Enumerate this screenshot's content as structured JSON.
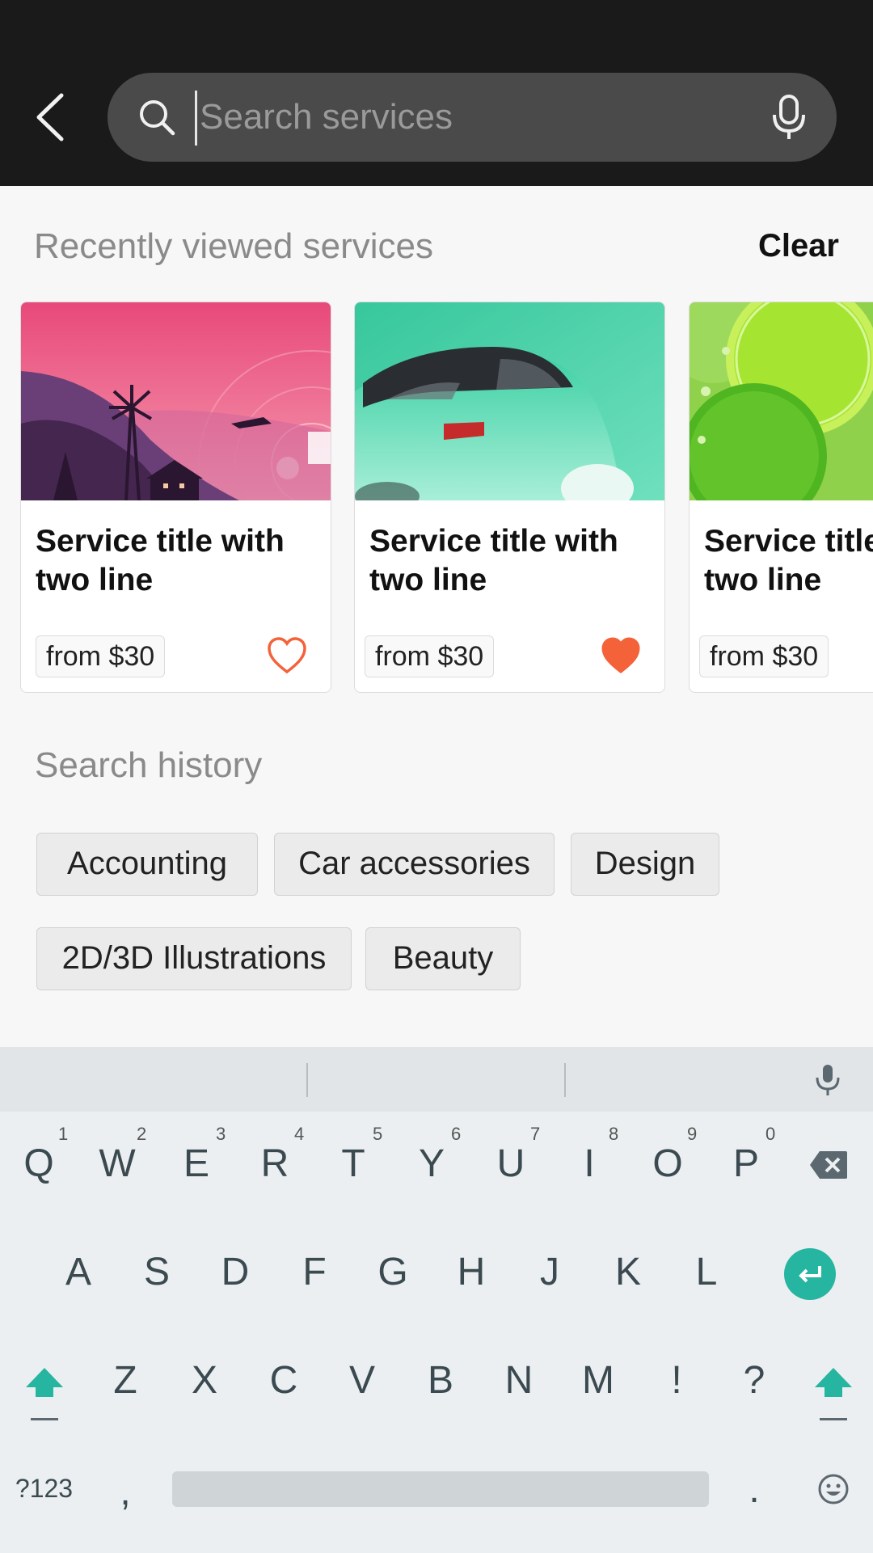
{
  "search": {
    "placeholder": "Search services",
    "value": ""
  },
  "recently_viewed": {
    "title": "Recently viewed services",
    "clear_label": "Clear",
    "cards": [
      {
        "title": "Service title with two line",
        "price": "from $30",
        "favorited": false,
        "image": "pink-landscape-windmill"
      },
      {
        "title": "Service title with two line",
        "price": "from $30",
        "favorited": true,
        "image": "green-car"
      },
      {
        "title": "Service title with two line",
        "price": "from $30",
        "favorited": false,
        "image": "lime-slices"
      }
    ]
  },
  "search_history": {
    "title": "Search history",
    "items": [
      "Accounting",
      "Car accessories",
      "Design",
      "2D/3D Illustrations",
      "Beauty"
    ]
  },
  "keyboard": {
    "row1": [
      "Q",
      "W",
      "E",
      "R",
      "T",
      "Y",
      "U",
      "I",
      "O",
      "P"
    ],
    "row1_nums": [
      "1",
      "2",
      "3",
      "4",
      "5",
      "6",
      "7",
      "8",
      "9",
      "0"
    ],
    "row2": [
      "A",
      "S",
      "D",
      "F",
      "G",
      "H",
      "J",
      "K",
      "L"
    ],
    "row3": [
      "Z",
      "X",
      "C",
      "V",
      "B",
      "N",
      "M",
      "!",
      "?"
    ],
    "symbols_label": "?123",
    "comma": ",",
    "period": "."
  },
  "colors": {
    "accent": "#26b5a0",
    "heart": "#f4623a",
    "topbar": "#1a1a1b"
  }
}
